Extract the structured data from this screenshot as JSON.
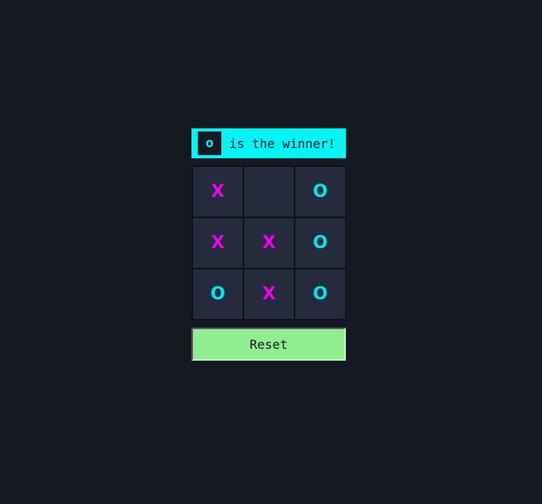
{
  "status": {
    "winner_symbol": "o",
    "message": "is the winner!"
  },
  "board": {
    "cells": [
      "X",
      "",
      "O",
      "X",
      "X",
      "O",
      "O",
      "X",
      "O"
    ]
  },
  "controls": {
    "reset_label": "Reset"
  },
  "colors": {
    "background": "#161824",
    "accent_cyan": "#00f5f5",
    "x_color": "#f000f0",
    "o_color": "#00e8f0",
    "cell_bg": "#262a3d",
    "reset_bg": "#90ee90"
  }
}
